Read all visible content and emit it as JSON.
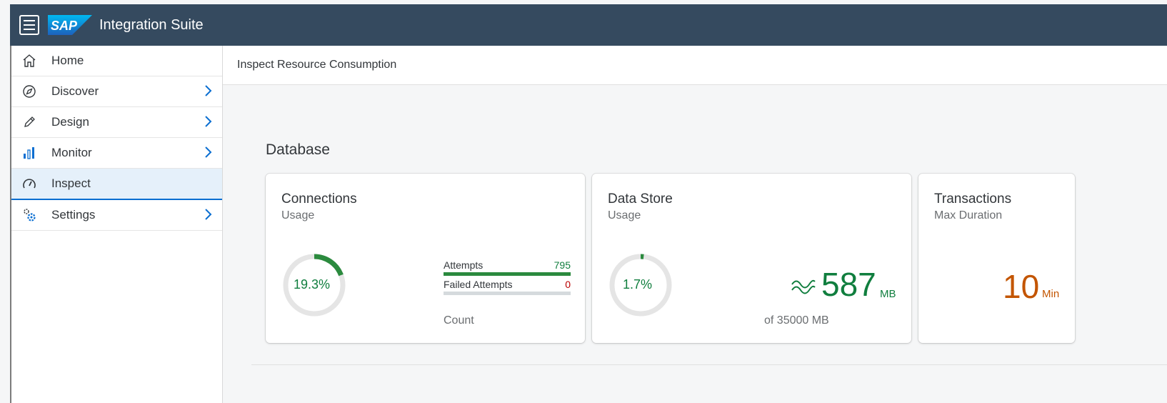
{
  "shell": {
    "menu_icon": "hamburger-icon",
    "logo": "SAP",
    "app_title": "Integration Suite"
  },
  "nav": [
    {
      "label": "Home",
      "icon": "home-icon",
      "has_chevron": false,
      "active": false
    },
    {
      "label": "Discover",
      "icon": "compass-icon",
      "has_chevron": true,
      "active": false
    },
    {
      "label": "Design",
      "icon": "pencil-icon",
      "has_chevron": true,
      "active": false
    },
    {
      "label": "Monitor",
      "icon": "bar-chart-icon",
      "has_chevron": true,
      "active": false
    },
    {
      "label": "Inspect",
      "icon": "gauge-icon",
      "has_chevron": false,
      "active": true
    },
    {
      "label": "Settings",
      "icon": "gears-icon",
      "has_chevron": true,
      "active": false
    }
  ],
  "page": {
    "subheader": "Inspect Resource Consumption",
    "section_title": "Database"
  },
  "cards": {
    "connections": {
      "title": "Connections",
      "subtitle": "Usage",
      "gauge_value": 19.3,
      "gauge_label": "19.3%",
      "attempts_label": "Attempts",
      "attempts_value": "795",
      "attempts_fill": 1.0,
      "failed_label": "Failed Attempts",
      "failed_value": "0",
      "failed_fill": 0.0,
      "footer": "Count"
    },
    "datastore": {
      "title": "Data Store",
      "subtitle": "Usage",
      "gauge_value": 1.7,
      "gauge_label": "1.7%",
      "trend_icon": "trend-wave-icon",
      "value": "587",
      "unit": "MB",
      "footer": "of 35000 MB"
    },
    "transactions": {
      "title": "Transactions",
      "subtitle": "Max Duration",
      "value": "10",
      "unit": "Min"
    }
  },
  "colors": {
    "shell": "#354a5f",
    "good": "#107e3e",
    "critical": "#bb0000",
    "warning": "#c35500",
    "active_border": "#0a6ed1"
  }
}
